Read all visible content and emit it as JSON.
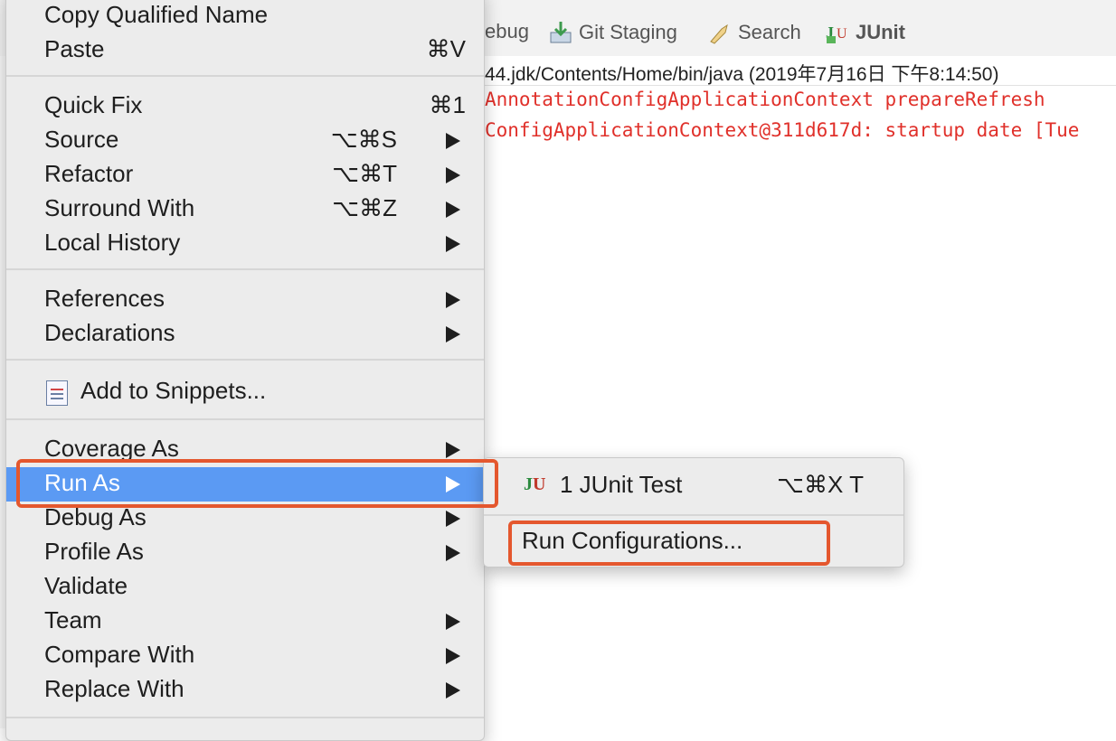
{
  "toolbar": {
    "debug_partial": "ebug",
    "git_staging": "Git Staging",
    "search": "Search",
    "junit": "JUnit"
  },
  "console": {
    "header": "44.jdk/Contents/Home/bin/java (2019年7月16日 下午8:14:50)",
    "lines": [
      "AnnotationConfigApplicationContext prepareRefresh",
      "ConfigApplicationContext@311d617d: startup date [Tue"
    ]
  },
  "menu": {
    "copy_qualified_name": "Copy Qualified Name",
    "paste": "Paste",
    "paste_shortcut": "⌘V",
    "quick_fix": "Quick Fix",
    "quick_fix_shortcut": "⌘1",
    "source": "Source",
    "source_shortcut": "⌥⌘S",
    "refactor": "Refactor",
    "refactor_shortcut": "⌥⌘T",
    "surround_with": "Surround With",
    "surround_with_shortcut": "⌥⌘Z",
    "local_history": "Local History",
    "references": "References",
    "declarations": "Declarations",
    "add_to_snippets": "Add to Snippets...",
    "coverage_as": "Coverage As",
    "run_as": "Run As",
    "debug_as": "Debug As",
    "profile_as": "Profile As",
    "validate": "Validate",
    "team": "Team",
    "compare_with": "Compare With",
    "replace_with": "Replace With"
  },
  "submenu": {
    "junit_test": "1 JUnit Test",
    "junit_test_shortcut": "⌥⌘X T",
    "run_configurations": "Run Configurations..."
  },
  "colors": {
    "menu_highlight": "#5b9af3",
    "annotation": "#e4572e",
    "console_error": "#e0302a"
  }
}
